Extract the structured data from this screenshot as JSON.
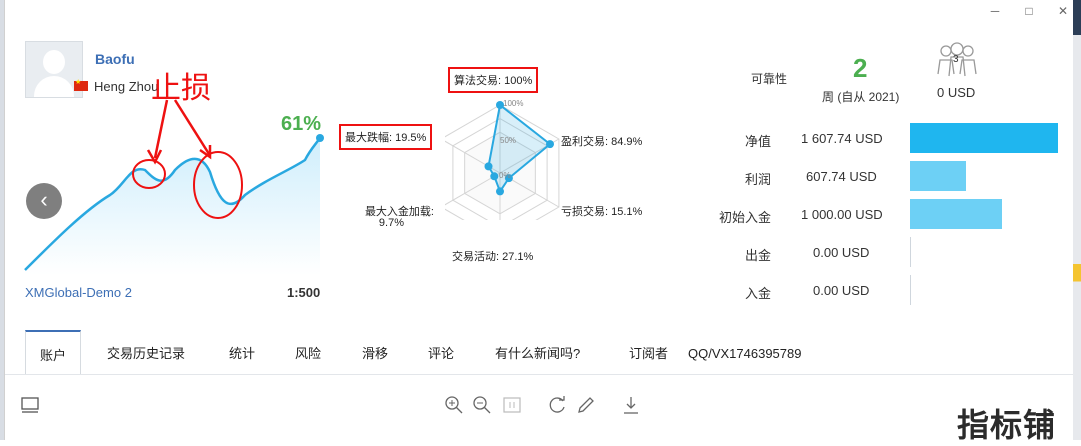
{
  "window": {
    "minimize": "─",
    "maximize": "□",
    "close": "✕"
  },
  "profile": {
    "name": "Baofu",
    "location": "Heng Zhou",
    "growth": "61%",
    "server": "XMGlobal-Demo 2",
    "leverage": "1:500"
  },
  "annotation": {
    "stop_loss": "止损"
  },
  "radar": {
    "algo_trading": "算法交易: 100%",
    "scale_100": "100%",
    "scale_50": "50%",
    "scale_0": "0%",
    "profit_trades": "盈利交易: 84.9%",
    "loss_trades": "亏损交易: 15.1%",
    "activity": "交易活动: 27.1%",
    "max_deposit_load": "最大入金加载:",
    "max_deposit_load_value": "9.7%",
    "max_drawdown": "最大跌幅: 19.5%",
    "values_percent": [
      100,
      84.9,
      15.1,
      27.1,
      9.7,
      19.5
    ]
  },
  "reliability": {
    "label": "可靠性",
    "weeks": "2",
    "since": "周 (自从 2021)"
  },
  "subscribers": {
    "count": "3",
    "price": "0 USD"
  },
  "stats": [
    {
      "label": "净值",
      "value": "1 607.74 USD",
      "amount": 1607.74
    },
    {
      "label": "利润",
      "value": "607.74 USD",
      "amount": 607.74
    },
    {
      "label": "初始入金",
      "value": "1 000.00 USD",
      "amount": 1000.0
    },
    {
      "label": "出金",
      "value": "0.00 USD",
      "amount": 0
    },
    {
      "label": "入金",
      "value": "0.00 USD",
      "amount": 0
    }
  ],
  "tabs": [
    "账户",
    "交易历史记录",
    "统计",
    "风险",
    "滑移",
    "评论",
    "有什么新闻吗?",
    "订阅者",
    "QQ/VX1746395789"
  ],
  "watermark": "指标铺",
  "colors": {
    "accent": "#3d6fb5",
    "growth": "#4caf50",
    "bar_dark": "#1fb6ef",
    "bar_light": "#6dd0f5",
    "annotation": "#e11111"
  }
}
